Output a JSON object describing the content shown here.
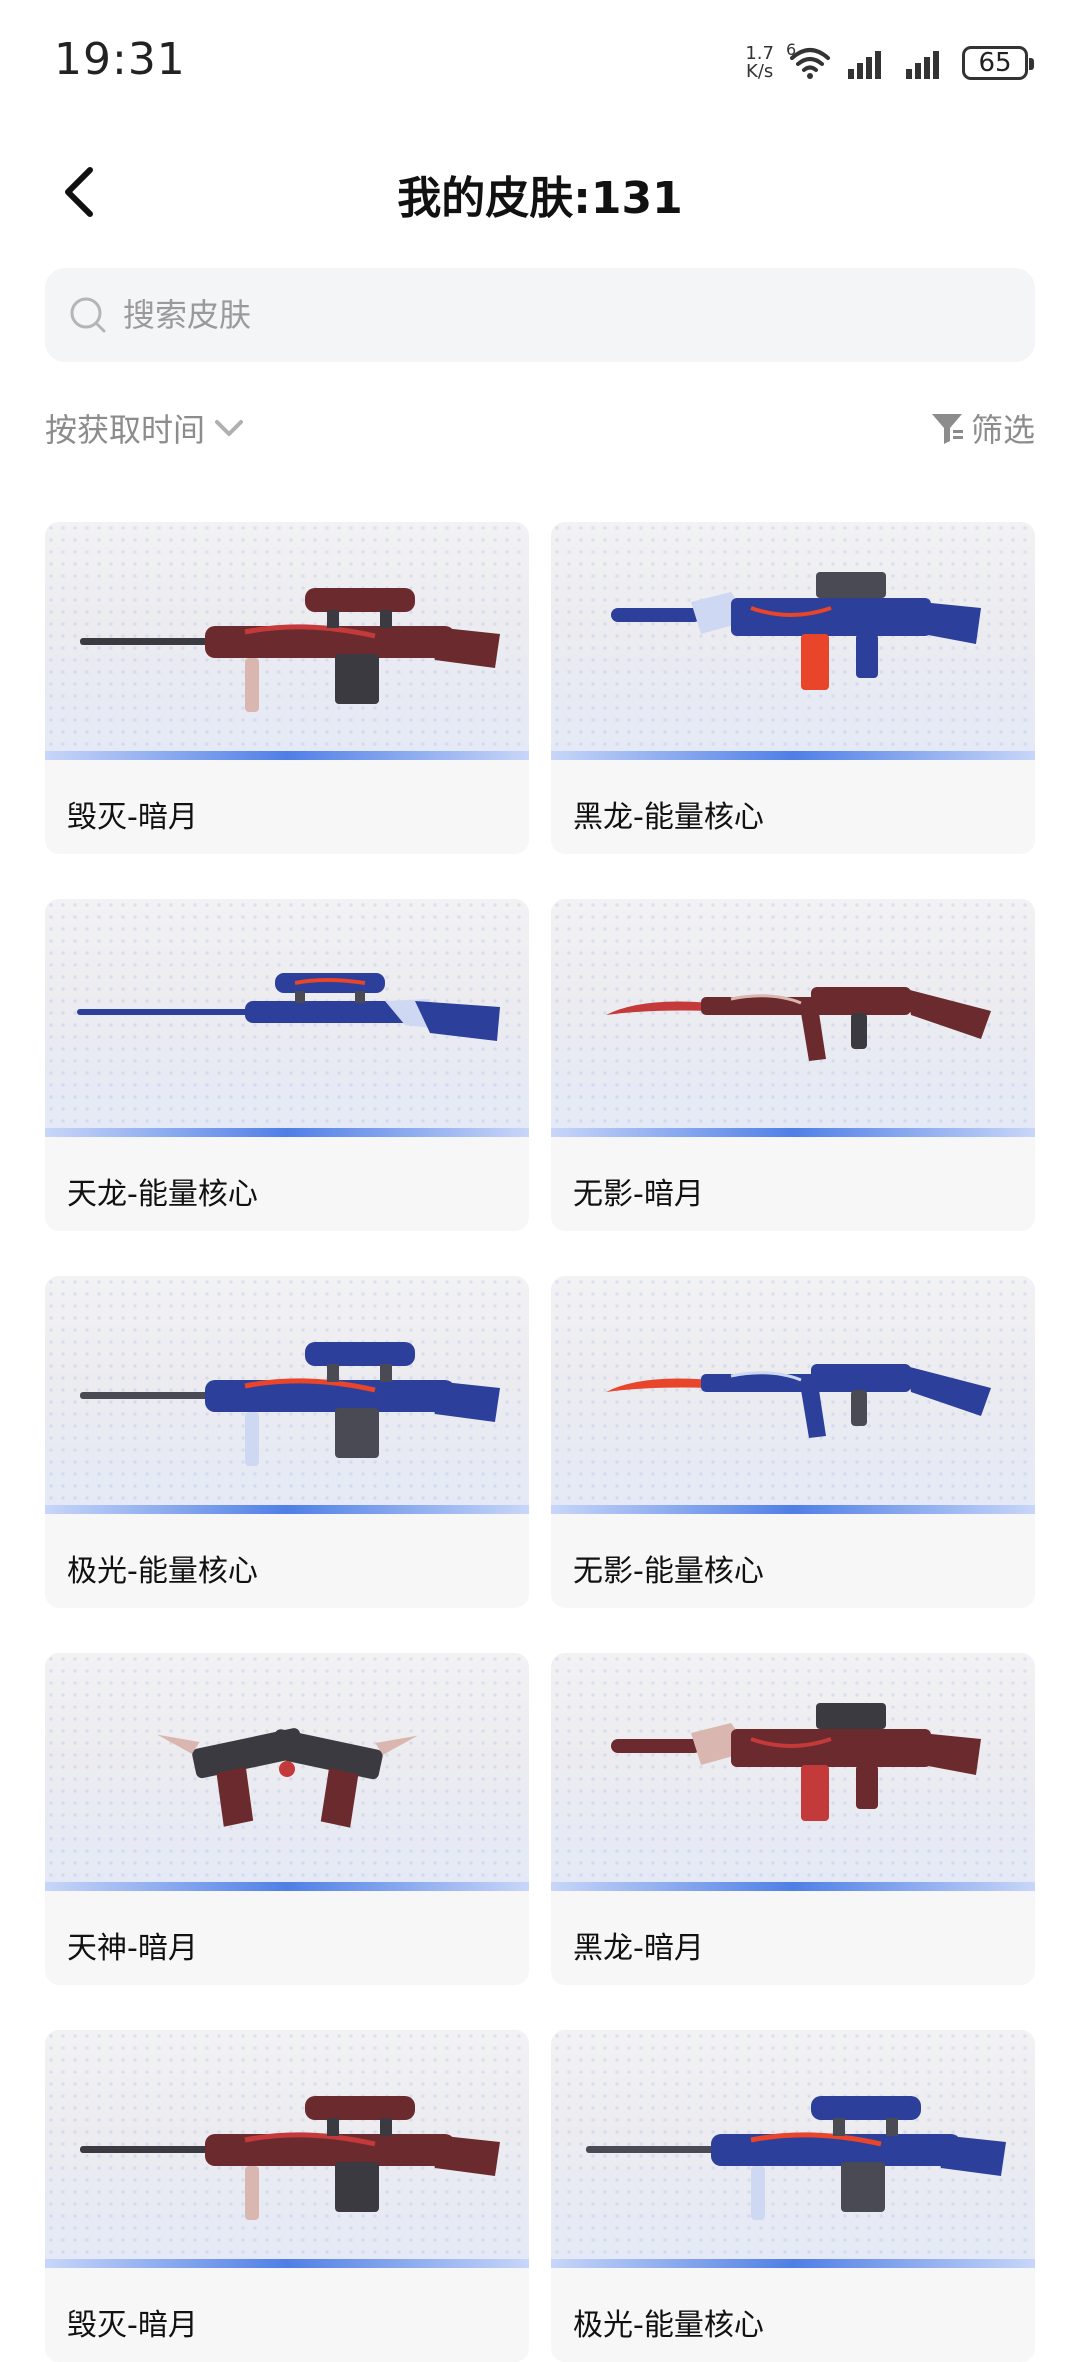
{
  "status_bar": {
    "time": "19:31",
    "net_speed_value": "1.7",
    "net_speed_unit": "K/s",
    "wifi_badge": "6",
    "battery": "65",
    "icons": [
      "wifi-icon",
      "signal-icon",
      "signal-icon",
      "battery-icon"
    ]
  },
  "header": {
    "title": "我的皮肤:131",
    "back_icon": "back-arrow-icon"
  },
  "search": {
    "placeholder": "搜索皮肤",
    "value": ""
  },
  "toolbar": {
    "sort_label": "按获取时间",
    "filter_label": "筛选"
  },
  "colors": {
    "accent_blue": "#4f7fe6",
    "card_bg": "#f7f7f7",
    "search_bg": "#f4f5f7",
    "muted_text": "#8c8c8c"
  },
  "skins": [
    {
      "name": "毁灭-暗月",
      "weapon": "sniper",
      "theme": "dark-red"
    },
    {
      "name": "黑龙-能量核心",
      "weapon": "rifle",
      "theme": "blue-energy"
    },
    {
      "name": "天龙-能量核心",
      "weapon": "long-sniper",
      "theme": "blue-energy"
    },
    {
      "name": "无影-暗月",
      "weapon": "ak",
      "theme": "dark-red"
    },
    {
      "name": "极光-能量核心",
      "weapon": "sniper",
      "theme": "blue-energy"
    },
    {
      "name": "无影-能量核心",
      "weapon": "ak",
      "theme": "blue-energy"
    },
    {
      "name": "天神-暗月",
      "weapon": "pistols",
      "theme": "dark-red"
    },
    {
      "name": "黑龙-暗月",
      "weapon": "rifle",
      "theme": "dark-red"
    },
    {
      "name": "毁灭-暗月",
      "weapon": "sniper",
      "theme": "dark-red"
    },
    {
      "name": "极光-能量核心",
      "weapon": "sniper",
      "theme": "blue-energy"
    }
  ]
}
